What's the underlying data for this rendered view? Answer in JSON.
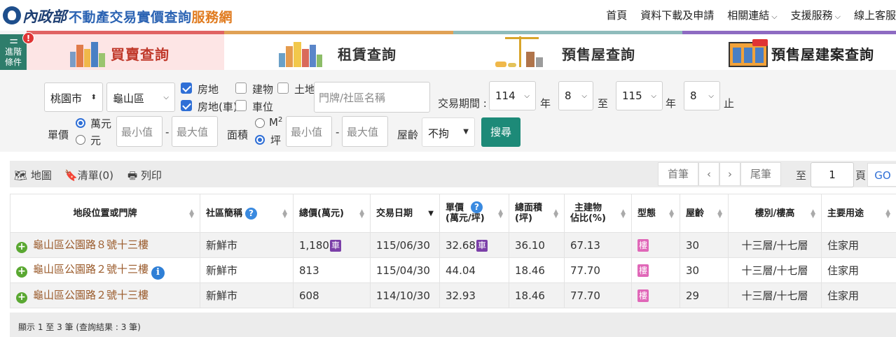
{
  "header": {
    "ministry": "內政部",
    "site_title": "不動產交易實價查詢",
    "site_title_suffix": "服務網",
    "nav": [
      {
        "label": "首頁",
        "has_menu": false
      },
      {
        "label": "資料下載及申請",
        "has_menu": false
      },
      {
        "label": "相關連結",
        "has_menu": true
      },
      {
        "label": "支援服務",
        "has_menu": true
      },
      {
        "label": "線上客服",
        "has_menu": false
      }
    ],
    "chevron": "⌵"
  },
  "advanced": {
    "label_line1": "進階",
    "label_line2": "條件",
    "alert": "!"
  },
  "tabs": [
    {
      "label": "買賣查詢",
      "active": true
    },
    {
      "label": "租賃查詢",
      "active": false
    },
    {
      "label": "預售屋查詢",
      "active": false
    },
    {
      "label": "預售屋建案查詢",
      "active": false
    }
  ],
  "filters": {
    "city": "桃園市",
    "district": "龜山區",
    "checkboxes": [
      {
        "label": "房地",
        "checked": true
      },
      {
        "label": "建物",
        "checked": false
      },
      {
        "label": "土地",
        "checked": false
      },
      {
        "label": "房地(車)",
        "checked": true
      },
      {
        "label": "車位",
        "checked": false
      }
    ],
    "address_placeholder": "門牌/社區名稱",
    "period_label": "交易期間 :",
    "start_year": "114",
    "start_month": "8",
    "end_year": "115",
    "end_month": "8",
    "year_unit": "年",
    "to_label": "至",
    "end_label": "止",
    "unit_price_label": "單價",
    "unit_options": [
      {
        "label": "萬元",
        "selected": true
      },
      {
        "label": "元",
        "selected": false
      }
    ],
    "min_placeholder": "最小值",
    "max_placeholder": "最大值",
    "dash": "-",
    "area_label": "面積",
    "area_options": [
      {
        "label": "M",
        "sup": "2",
        "selected": false
      },
      {
        "label": "坪",
        "sup": "",
        "selected": true
      }
    ],
    "age_label": "屋齡",
    "age_value": "不拘",
    "search_label": "搜尋"
  },
  "toolbar": {
    "map_label": "地圖",
    "list_label": "清單(0)",
    "print_label": "列印",
    "first_label": "首筆",
    "prev_label": "‹",
    "next_label": "›",
    "last_label": "尾筆",
    "goto_label": "至",
    "page_value": "1",
    "page_unit": "頁",
    "go_label": "GO"
  },
  "table": {
    "columns": [
      {
        "label": "地段位置或門牌",
        "sort": "both",
        "help": false
      },
      {
        "label": "社區簡稱",
        "sort": "both",
        "help": true
      },
      {
        "label": "總價(萬元)",
        "sort": "both",
        "help": false
      },
      {
        "label": "交易日期",
        "sort": "down",
        "help": false
      },
      {
        "label": "單價\n(萬元/坪)",
        "sort": "both",
        "help": true
      },
      {
        "label": "總面積\n(坪)",
        "sort": "both",
        "help": false
      },
      {
        "label": "主建物\n佔比(%)",
        "sort": "both",
        "help": false
      },
      {
        "label": "型態",
        "sort": "both",
        "help": false
      },
      {
        "label": "屋齡",
        "sort": "both",
        "help": false
      },
      {
        "label": "樓別/樓高",
        "sort": "both",
        "help": false
      },
      {
        "label": "主要用途",
        "sort": "both",
        "help": false
      }
    ],
    "car_tag": "車",
    "type_tag": "樓",
    "rows": [
      {
        "address": "龜山區公園路８號十三樓",
        "info": false,
        "community": "新鮮市",
        "total_price": "1,180",
        "total_car": true,
        "date": "115/06/30",
        "unit_price": "32.68",
        "unit_car": true,
        "area": "36.10",
        "main_ratio": "67.13",
        "age": "30",
        "floor": "十三層/十七層",
        "usage": "住家用"
      },
      {
        "address": "龜山區公園路２號十三樓",
        "info": true,
        "community": "新鮮市",
        "total_price": "813",
        "total_car": false,
        "date": "115/04/30",
        "unit_price": "44.04",
        "unit_car": false,
        "area": "18.46",
        "main_ratio": "77.70",
        "age": "30",
        "floor": "十三層/十七層",
        "usage": "住家用"
      },
      {
        "address": "龜山區公園路２號十三樓",
        "info": false,
        "community": "新鮮市",
        "total_price": "608",
        "total_car": false,
        "date": "114/10/30",
        "unit_price": "32.93",
        "unit_car": false,
        "area": "18.46",
        "main_ratio": "77.70",
        "age": "29",
        "floor": "十三層/十七層",
        "usage": "住家用"
      }
    ]
  },
  "footer": {
    "summary": "顯示 1 至 3 筆 (查詢結果 : 3 筆)"
  },
  "colors": {
    "brand_blue": "#2b63b3",
    "brand_orange": "#e07b1f",
    "advanced_green": "#2e7d6b",
    "search_green": "#1d8a78",
    "buy_red": "#e06363",
    "rent_orange": "#e0a256",
    "presale_teal": "#8fbcbc",
    "project_purple": "#8e6bc2"
  }
}
